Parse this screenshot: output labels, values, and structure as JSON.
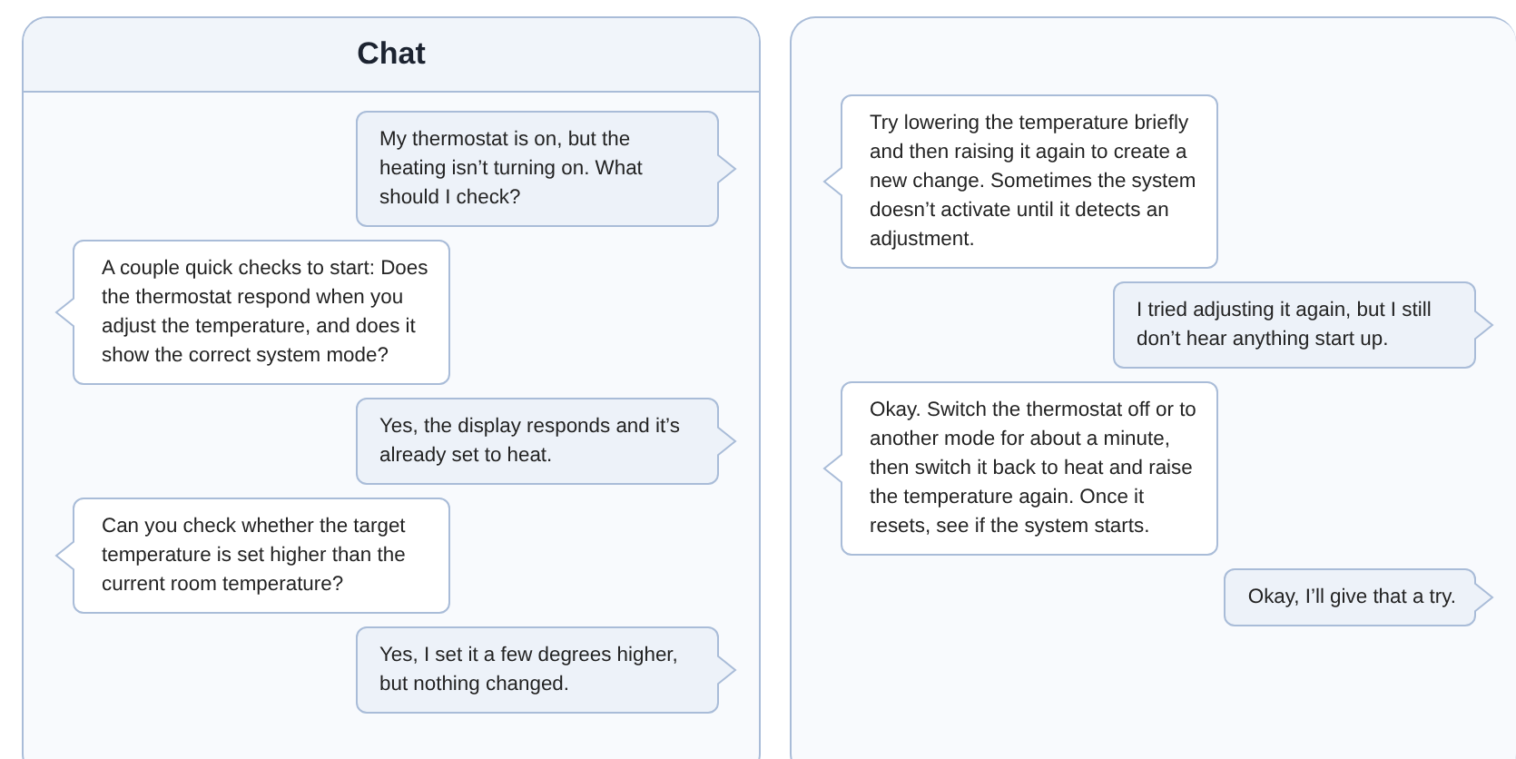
{
  "panels": [
    {
      "title": "Chat",
      "messages": [
        {
          "kind": "user",
          "text": "My thermostat is on, but the heating isn’t turning on. What should I check?"
        },
        {
          "kind": "assistant",
          "text": "A couple quick checks to start: Does the thermostat respond when you adjust the temperature, and does it show the correct system mode?"
        },
        {
          "kind": "user",
          "text": "Yes, the display responds and it’s already set to heat."
        },
        {
          "kind": "assistant",
          "text": "Can you check whether the target temperature is set higher than the current room temperature?"
        },
        {
          "kind": "user",
          "text": "Yes, I set it a few degrees higher, but nothing changed."
        }
      ]
    },
    {
      "messages": [
        {
          "kind": "assistant",
          "text": "Try lowering the temperature briefly and then raising it again to create a new change. Sometimes the system doesn’t activate until it detects an adjustment."
        },
        {
          "kind": "user",
          "text": "I tried adjusting it again, but I still don’t hear anything start up."
        },
        {
          "kind": "assistant",
          "text": "Okay. Switch the thermostat off or to another mode for about a minute, then switch it back to heat and raise the temperature again. Once it resets, see if the system starts."
        },
        {
          "kind": "user",
          "text": "Okay, I’ll give that a try."
        }
      ]
    }
  ]
}
